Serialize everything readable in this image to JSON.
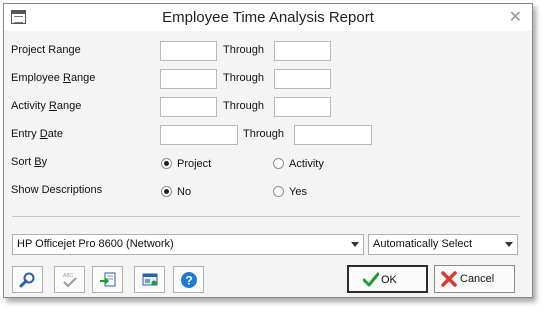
{
  "window": {
    "title": "Employee Time Analysis Report"
  },
  "fields": {
    "project_range": {
      "prefix": "Project Range",
      "through": "Through"
    },
    "employee_range": {
      "prefix": "Employee ",
      "mnemonic": "R",
      "suffix": "ange",
      "through": "Through"
    },
    "activity_range": {
      "prefix": "Activity ",
      "mnemonic": "R",
      "suffix": "ange",
      "through": "Through"
    },
    "entry_date": {
      "prefix": "Entry ",
      "mnemonic": "D",
      "suffix": "ate",
      "through": "Through"
    }
  },
  "sort_by": {
    "prefix": "Sort ",
    "mnemonic": "B",
    "suffix": "y",
    "options": [
      "Project",
      "Activity"
    ],
    "selected": "Project"
  },
  "show_descriptions": {
    "label": "Show Descriptions",
    "options": [
      "No",
      "Yes"
    ],
    "selected": "No"
  },
  "printer": {
    "selected": "HP Officejet Pro 8600 (Network)"
  },
  "paper": {
    "selected": "Automatically Select"
  },
  "toolbar": {
    "icons": [
      "search-icon",
      "spellcheck-icon",
      "export-icon",
      "print-preview-icon",
      "help-icon"
    ]
  },
  "buttons": {
    "ok": "OK",
    "cancel": "Cancel"
  },
  "colors": {
    "ok_check": "#1a9f33",
    "cancel_x": "#d93b2f",
    "help_blue": "#1f7ad6"
  }
}
